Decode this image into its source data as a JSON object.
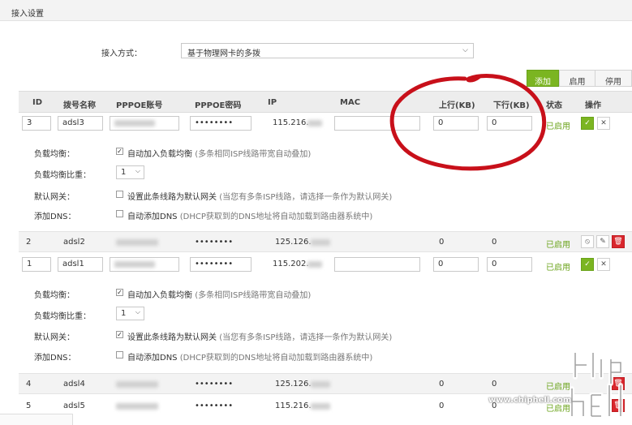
{
  "page": {
    "title": "接入设置"
  },
  "access": {
    "label": "接入方式：",
    "selected": "基于物理网卡的多拨"
  },
  "toolbar": {
    "add_label": "添加",
    "enable_label": "启用",
    "disable_label": "停用"
  },
  "table": {
    "headers": {
      "id": "ID",
      "name": "拨号名称",
      "pppoe_user": "PPPOE账号",
      "pppoe_pass": "PPPOE密码",
      "ip": "IP",
      "mac": "MAC",
      "up": "上行(KB)",
      "down": "下行(KB)",
      "status": "状态",
      "action": "操作"
    },
    "rows": [
      {
        "id": "3",
        "name": "adsl3",
        "password": "••••••••",
        "ip": "115.216.",
        "up": "0",
        "down": "0",
        "status": "已启用"
      },
      {
        "id": "2",
        "name": "adsl2",
        "password": "••••••••",
        "ip": "125.126.",
        "up": "0",
        "down": "0",
        "status": "已启用"
      },
      {
        "id": "1",
        "name": "adsl1",
        "password": "••••••••",
        "ip": "115.202.",
        "up": "0",
        "down": "0",
        "status": "已启用"
      },
      {
        "id": "4",
        "name": "adsl4",
        "password": "••••••••",
        "ip": "125.126.",
        "up": "0",
        "down": "0",
        "status": "已启用"
      },
      {
        "id": "5",
        "name": "adsl5",
        "password": "••••••••",
        "ip": "115.216.",
        "up": "0",
        "down": "0",
        "status": "已启用"
      }
    ]
  },
  "details": [
    {
      "lb_label": "负载均衡：",
      "lb_text": "自动加入负载均衡",
      "lb_hint": "(多条相同ISP线路带宽自动叠加)",
      "lb_checked": "✓",
      "ratio_label": "负载均衡比重：",
      "ratio_value": "1",
      "gw_label": "默认网关：",
      "gw_text": "设置此条线路为默认网关",
      "gw_hint": "(当您有多条ISP线路，请选择一条作为默认网关)",
      "gw_checked": "",
      "dns_label": "添加DNS：",
      "dns_text": "自动添加DNS",
      "dns_hint": "(DHCP获取到的DNS地址将自动加载到路由器系统中)",
      "dns_checked": ""
    },
    {
      "lb_label": "负载均衡：",
      "lb_text": "自动加入负载均衡",
      "lb_hint": "(多条相同ISP线路带宽自动叠加)",
      "lb_checked": "✓",
      "ratio_label": "负载均衡比重：",
      "ratio_value": "1",
      "gw_label": "默认网关：",
      "gw_text": "设置此条线路为默认网关",
      "gw_hint": "(当您有多条ISP线路，请选择一条作为默认网关)",
      "gw_checked": "✓",
      "dns_label": "添加DNS：",
      "dns_text": "自动添加DNS",
      "dns_hint": "(DHCP获取到的DNS地址将自动加载到路由器系统中)",
      "dns_checked": ""
    }
  ],
  "watermark": {
    "url": "www.chiphell.com",
    "logo_text": "chip hell"
  },
  "colors": {
    "accent": "#7bb521",
    "danger": "#d9262c",
    "scribble": "#c8101a"
  },
  "icons": {
    "confirm": "check-icon",
    "cancel": "close-icon",
    "disable": "ban-icon",
    "edit": "pencil-icon",
    "delete": "trash-icon",
    "dropdown": "chevron-down-icon"
  }
}
